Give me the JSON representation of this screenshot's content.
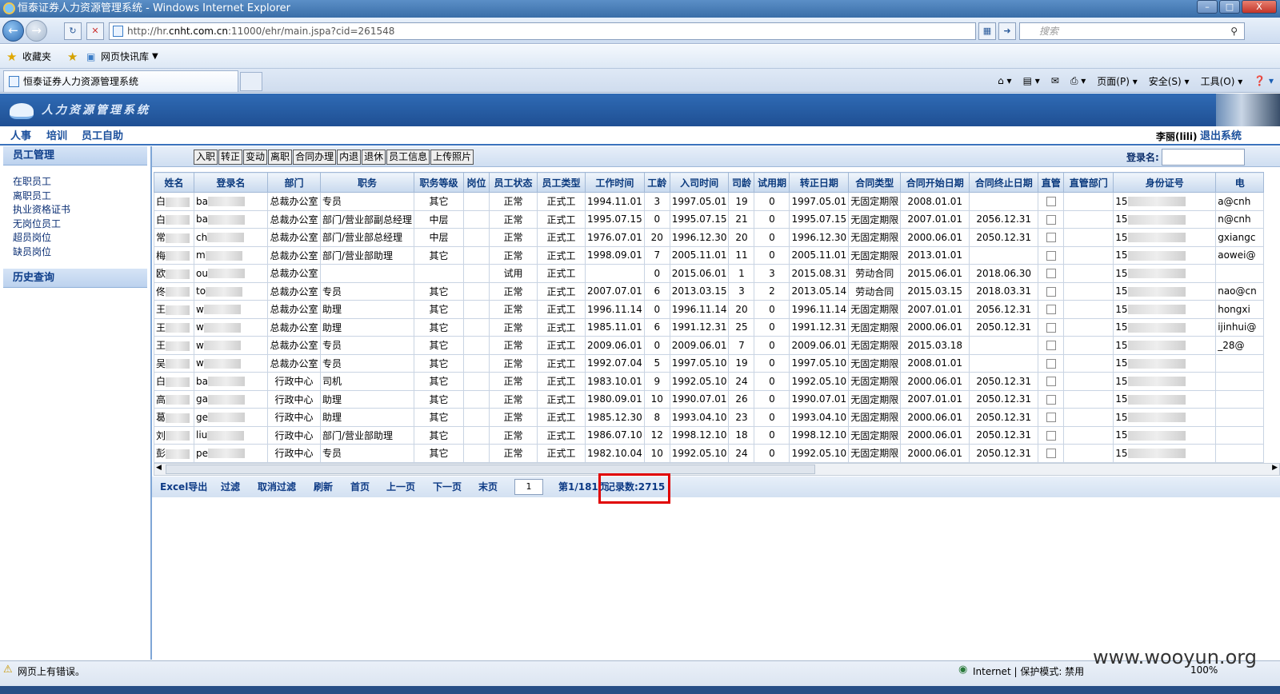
{
  "window": {
    "title": "恒泰证券人力资源管理系统 - Windows Internet Explorer",
    "minimize": "–",
    "maximize": "□",
    "close": "X"
  },
  "browser": {
    "url_prefix": "http://hr.",
    "url_host": "cnht.com.cn",
    "url_rest": ":11000/ehr/main.jspa?cid=261548",
    "search_placeholder": "搜索",
    "favorites": "收藏夹",
    "web_slice": "网页快讯库",
    "tab_title": "恒泰证券人力资源管理系统",
    "cmd_page": "页面(P)",
    "cmd_safety": "安全(S)",
    "cmd_tools": "工具(O)"
  },
  "app": {
    "title": "人力资源管理系统"
  },
  "mainnav": {
    "items": [
      "人事",
      "培训",
      "员工自助"
    ],
    "user": "李丽(lili)",
    "logout": "退出系统"
  },
  "sidebar": {
    "section1": "员工管理",
    "items": [
      "在职员工",
      "离职员工",
      "执业资格证书",
      "无岗位员工",
      "超员岗位",
      "缺员岗位"
    ],
    "section2": "历史查询"
  },
  "toolbar": {
    "actions": [
      "入职",
      "转正",
      "变动",
      "离职",
      "合同办理",
      "内退",
      "退休",
      "员工信息",
      "上传照片"
    ],
    "login_label": "登录名:"
  },
  "grid": {
    "columns": [
      "姓名",
      "登录名",
      "部门",
      "职务",
      "职务等级",
      "岗位",
      "员工状态",
      "员工类型",
      "工作时间",
      "工龄",
      "入司时间",
      "司龄",
      "试用期",
      "转正日期",
      "合同类型",
      "合同开始日期",
      "合同终止日期",
      "直管",
      "直管部门",
      "身份证号",
      "电"
    ],
    "rows": [
      {
        "name": "白",
        "login": "ba",
        "dept": "总裁办公室",
        "title": "专员",
        "grade": "其它",
        "status": "正常",
        "type": "正式工",
        "work": "1994.11.01",
        "seniority": "3",
        "join": "1997.05.01",
        "tenure": "19",
        "probation": "0",
        "regular": "1997.05.01",
        "contract": "无固定期限",
        "cstart": "2008.01.01",
        "cend": "",
        "id": "15",
        "email": "a@cnh"
      },
      {
        "name": "白",
        "login": "ba",
        "dept": "总裁办公室",
        "title": "部门/营业部副总经理",
        "grade": "中层",
        "status": "正常",
        "type": "正式工",
        "work": "1995.07.15",
        "seniority": "0",
        "join": "1995.07.15",
        "tenure": "21",
        "probation": "0",
        "regular": "1995.07.15",
        "contract": "无固定期限",
        "cstart": "2007.01.01",
        "cend": "2056.12.31",
        "id": "15",
        "email": "n@cnh"
      },
      {
        "name": "常",
        "login": "ch",
        "dept": "总裁办公室",
        "title": "部门/营业部总经理",
        "grade": "中层",
        "status": "正常",
        "type": "正式工",
        "work": "1976.07.01",
        "seniority": "20",
        "join": "1996.12.30",
        "tenure": "20",
        "probation": "0",
        "regular": "1996.12.30",
        "contract": "无固定期限",
        "cstart": "2000.06.01",
        "cend": "2050.12.31",
        "id": "15",
        "email": "gxiangc"
      },
      {
        "name": "梅",
        "login": "m",
        "dept": "总裁办公室",
        "title": "部门/营业部助理",
        "grade": "其它",
        "status": "正常",
        "type": "正式工",
        "work": "1998.09.01",
        "seniority": "7",
        "join": "2005.11.01",
        "tenure": "11",
        "probation": "0",
        "regular": "2005.11.01",
        "contract": "无固定期限",
        "cstart": "2013.01.01",
        "cend": "",
        "id": "15",
        "email": "aowei@"
      },
      {
        "name": "欧",
        "login": "ou",
        "dept": "总裁办公室",
        "title": "",
        "grade": "",
        "status": "试用",
        "type": "正式工",
        "work": "",
        "seniority": "0",
        "join": "2015.06.01",
        "tenure": "1",
        "probation": "3",
        "regular": "2015.08.31",
        "contract": "劳动合同",
        "cstart": "2015.06.01",
        "cend": "2018.06.30",
        "id": "15",
        "email": ""
      },
      {
        "name": "佟",
        "login": "to",
        "dept": "总裁办公室",
        "title": "专员",
        "grade": "其它",
        "status": "正常",
        "type": "正式工",
        "work": "2007.07.01",
        "seniority": "6",
        "join": "2013.03.15",
        "tenure": "3",
        "probation": "2",
        "regular": "2013.05.14",
        "contract": "劳动合同",
        "cstart": "2015.03.15",
        "cend": "2018.03.31",
        "id": "15",
        "email": "nao@cn"
      },
      {
        "name": "王",
        "login": "w",
        "dept": "总裁办公室",
        "title": "助理",
        "grade": "其它",
        "status": "正常",
        "type": "正式工",
        "work": "1996.11.14",
        "seniority": "0",
        "join": "1996.11.14",
        "tenure": "20",
        "probation": "0",
        "regular": "1996.11.14",
        "contract": "无固定期限",
        "cstart": "2007.01.01",
        "cend": "2056.12.31",
        "id": "15",
        "email": "hongxi"
      },
      {
        "name": "王",
        "login": "w",
        "dept": "总裁办公室",
        "title": "助理",
        "grade": "其它",
        "status": "正常",
        "type": "正式工",
        "work": "1985.11.01",
        "seniority": "6",
        "join": "1991.12.31",
        "tenure": "25",
        "probation": "0",
        "regular": "1991.12.31",
        "contract": "无固定期限",
        "cstart": "2000.06.01",
        "cend": "2050.12.31",
        "id": "15",
        "email": "ijinhui@"
      },
      {
        "name": "王",
        "login": "w",
        "dept": "总裁办公室",
        "title": "专员",
        "grade": "其它",
        "status": "正常",
        "type": "正式工",
        "work": "2009.06.01",
        "seniority": "0",
        "join": "2009.06.01",
        "tenure": "7",
        "probation": "0",
        "regular": "2009.06.01",
        "contract": "无固定期限",
        "cstart": "2015.03.18",
        "cend": "",
        "id": "15",
        "email": "_28@"
      },
      {
        "name": "吴",
        "login": "w",
        "dept": "总裁办公室",
        "title": "专员",
        "grade": "其它",
        "status": "正常",
        "type": "正式工",
        "work": "1992.07.04",
        "seniority": "5",
        "join": "1997.05.10",
        "tenure": "19",
        "probation": "0",
        "regular": "1997.05.10",
        "contract": "无固定期限",
        "cstart": "2008.01.01",
        "cend": "",
        "id": "15",
        "email": ""
      },
      {
        "name": "白",
        "login": "ba",
        "dept": "行政中心",
        "title": "司机",
        "grade": "其它",
        "status": "正常",
        "type": "正式工",
        "work": "1983.10.01",
        "seniority": "9",
        "join": "1992.05.10",
        "tenure": "24",
        "probation": "0",
        "regular": "1992.05.10",
        "contract": "无固定期限",
        "cstart": "2000.06.01",
        "cend": "2050.12.31",
        "id": "15",
        "email": ""
      },
      {
        "name": "高",
        "login": "ga",
        "dept": "行政中心",
        "title": "助理",
        "grade": "其它",
        "status": "正常",
        "type": "正式工",
        "work": "1980.09.01",
        "seniority": "10",
        "join": "1990.07.01",
        "tenure": "26",
        "probation": "0",
        "regular": "1990.07.01",
        "contract": "无固定期限",
        "cstart": "2007.01.01",
        "cend": "2050.12.31",
        "id": "15",
        "email": ""
      },
      {
        "name": "葛",
        "login": "ge",
        "dept": "行政中心",
        "title": "助理",
        "grade": "其它",
        "status": "正常",
        "type": "正式工",
        "work": "1985.12.30",
        "seniority": "8",
        "join": "1993.04.10",
        "tenure": "23",
        "probation": "0",
        "regular": "1993.04.10",
        "contract": "无固定期限",
        "cstart": "2000.06.01",
        "cend": "2050.12.31",
        "id": "15",
        "email": ""
      },
      {
        "name": "刘",
        "login": "liu",
        "dept": "行政中心",
        "title": "部门/营业部助理",
        "grade": "其它",
        "status": "正常",
        "type": "正式工",
        "work": "1986.07.10",
        "seniority": "12",
        "join": "1998.12.10",
        "tenure": "18",
        "probation": "0",
        "regular": "1998.12.10",
        "contract": "无固定期限",
        "cstart": "2000.06.01",
        "cend": "2050.12.31",
        "id": "15",
        "email": ""
      },
      {
        "name": "彭",
        "login": "pe",
        "dept": "行政中心",
        "title": "专员",
        "grade": "其它",
        "status": "正常",
        "type": "正式工",
        "work": "1982.10.04",
        "seniority": "10",
        "join": "1992.05.10",
        "tenure": "24",
        "probation": "0",
        "regular": "1992.05.10",
        "contract": "无固定期限",
        "cstart": "2000.06.01",
        "cend": "2050.12.31",
        "id": "15",
        "email": ""
      }
    ]
  },
  "pager": {
    "export": "Excel导出",
    "filter": "过滤",
    "clear_filter": "取消过滤",
    "refresh": "刷新",
    "first": "首页",
    "prev": "上一页",
    "next": "下一页",
    "last": "末页",
    "page_value": "1",
    "page_info": "第1/181页",
    "record_count": "记录数:2715"
  },
  "status": {
    "error": "网页上有错误。",
    "zone": "Internet | 保护模式: 禁用",
    "zoom": "100%"
  },
  "watermark": "www.wooyun.org"
}
